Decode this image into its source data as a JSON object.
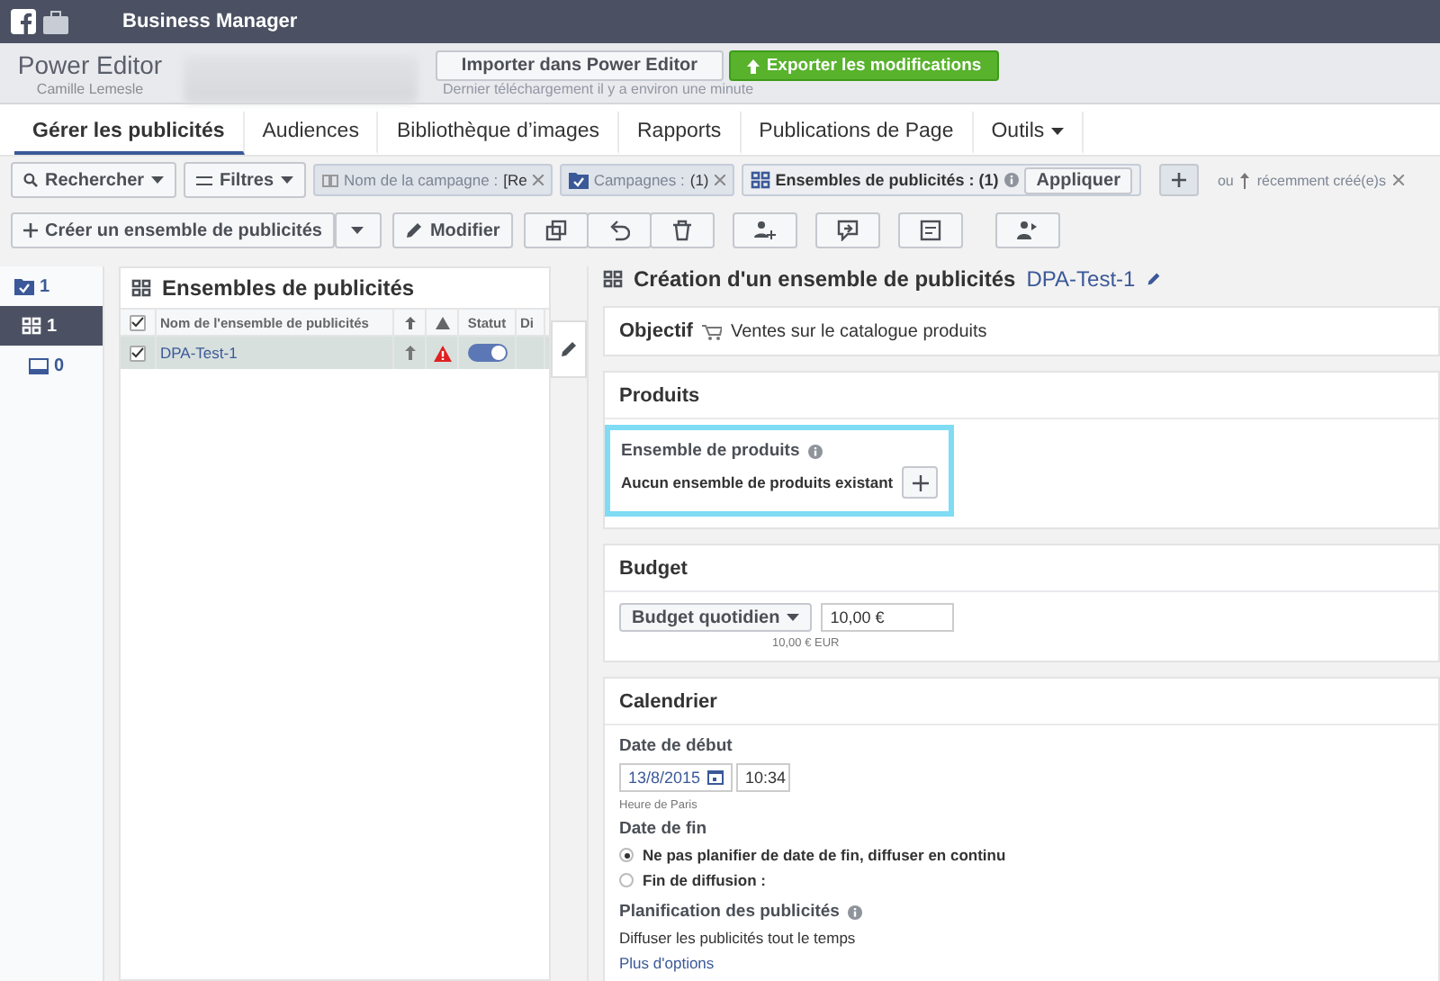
{
  "top_bar": {
    "title": "Business Manager"
  },
  "header": {
    "app_name": "Power Editor",
    "user": "Camille Lemesle",
    "import_button": "Importer dans Power Editor",
    "export_button": "Exporter les modifications",
    "last_download": "Dernier téléchargement il y a environ une minute"
  },
  "tabs": [
    {
      "label": "Gérer les publicités",
      "selected": true,
      "dropdown": false
    },
    {
      "label": "Audiences",
      "selected": false,
      "dropdown": false
    },
    {
      "label": "Bibliothèque d’images",
      "selected": false,
      "dropdown": false
    },
    {
      "label": "Rapports",
      "selected": false,
      "dropdown": false
    },
    {
      "label": "Publications de Page",
      "selected": false,
      "dropdown": false
    },
    {
      "label": "Outils",
      "selected": false,
      "dropdown": true
    }
  ],
  "filter_bar": {
    "search_button": "Rechercher",
    "filter_button": "Filtres",
    "chips": [
      {
        "kind": "text",
        "label": "Nom de la campagne :",
        "value": "[Re"
      },
      {
        "kind": "campaign",
        "label": "Campagnes :",
        "value": "(1)"
      },
      {
        "kind": "adset",
        "label": "Ensembles de publicités : (1)",
        "button": "Appliquer"
      }
    ],
    "or_label": "ou",
    "recent_label": "récemment créé(e)s"
  },
  "actions": {
    "create_button": "Créer un ensemble de publicités",
    "edit_button": "Modifier"
  },
  "tree": [
    {
      "kind": "campaign",
      "count": "1",
      "selected": false
    },
    {
      "kind": "adset",
      "count": "1",
      "selected": true
    },
    {
      "kind": "ad",
      "count": "0",
      "selected": false
    }
  ],
  "table": {
    "title": "Ensembles de publicités",
    "header_checked": true,
    "columns": [
      "Nom de l'ensemble de publicités",
      "Statut",
      "Di"
    ],
    "rows": [
      {
        "name": "DPA-Test-1",
        "checked": true,
        "selected": true,
        "on": true,
        "warning": true
      }
    ]
  },
  "detail": {
    "title": "Création d'un ensemble de publicités",
    "name": "DPA-Test-1",
    "objective": {
      "label": "Objectif",
      "value": "Ventes sur le catalogue produits"
    },
    "products": {
      "title": "Produits",
      "highlighted": true,
      "field_label": "Ensemble de produits",
      "empty_text": "Aucun ensemble de produits existant"
    },
    "budget": {
      "title": "Budget",
      "type": "Budget quotidien",
      "amount": "10,00 €",
      "hint": "10,00 € EUR"
    },
    "schedule": {
      "title": "Calendrier",
      "start_label": "Date de début",
      "start_date": "13/8/2015",
      "start_time": "10:34",
      "timezone": "Heure de Paris",
      "end_label": "Date de fin",
      "end_options": [
        {
          "label": "Ne pas planifier de date de fin, diffuser en continu",
          "selected": true
        },
        {
          "label": "Fin de diffusion :",
          "selected": false
        }
      ],
      "planning_label": "Planification des publicités",
      "planning_text": "Diffuser les publicités tout le temps",
      "more_link": "Plus d'options"
    }
  }
}
